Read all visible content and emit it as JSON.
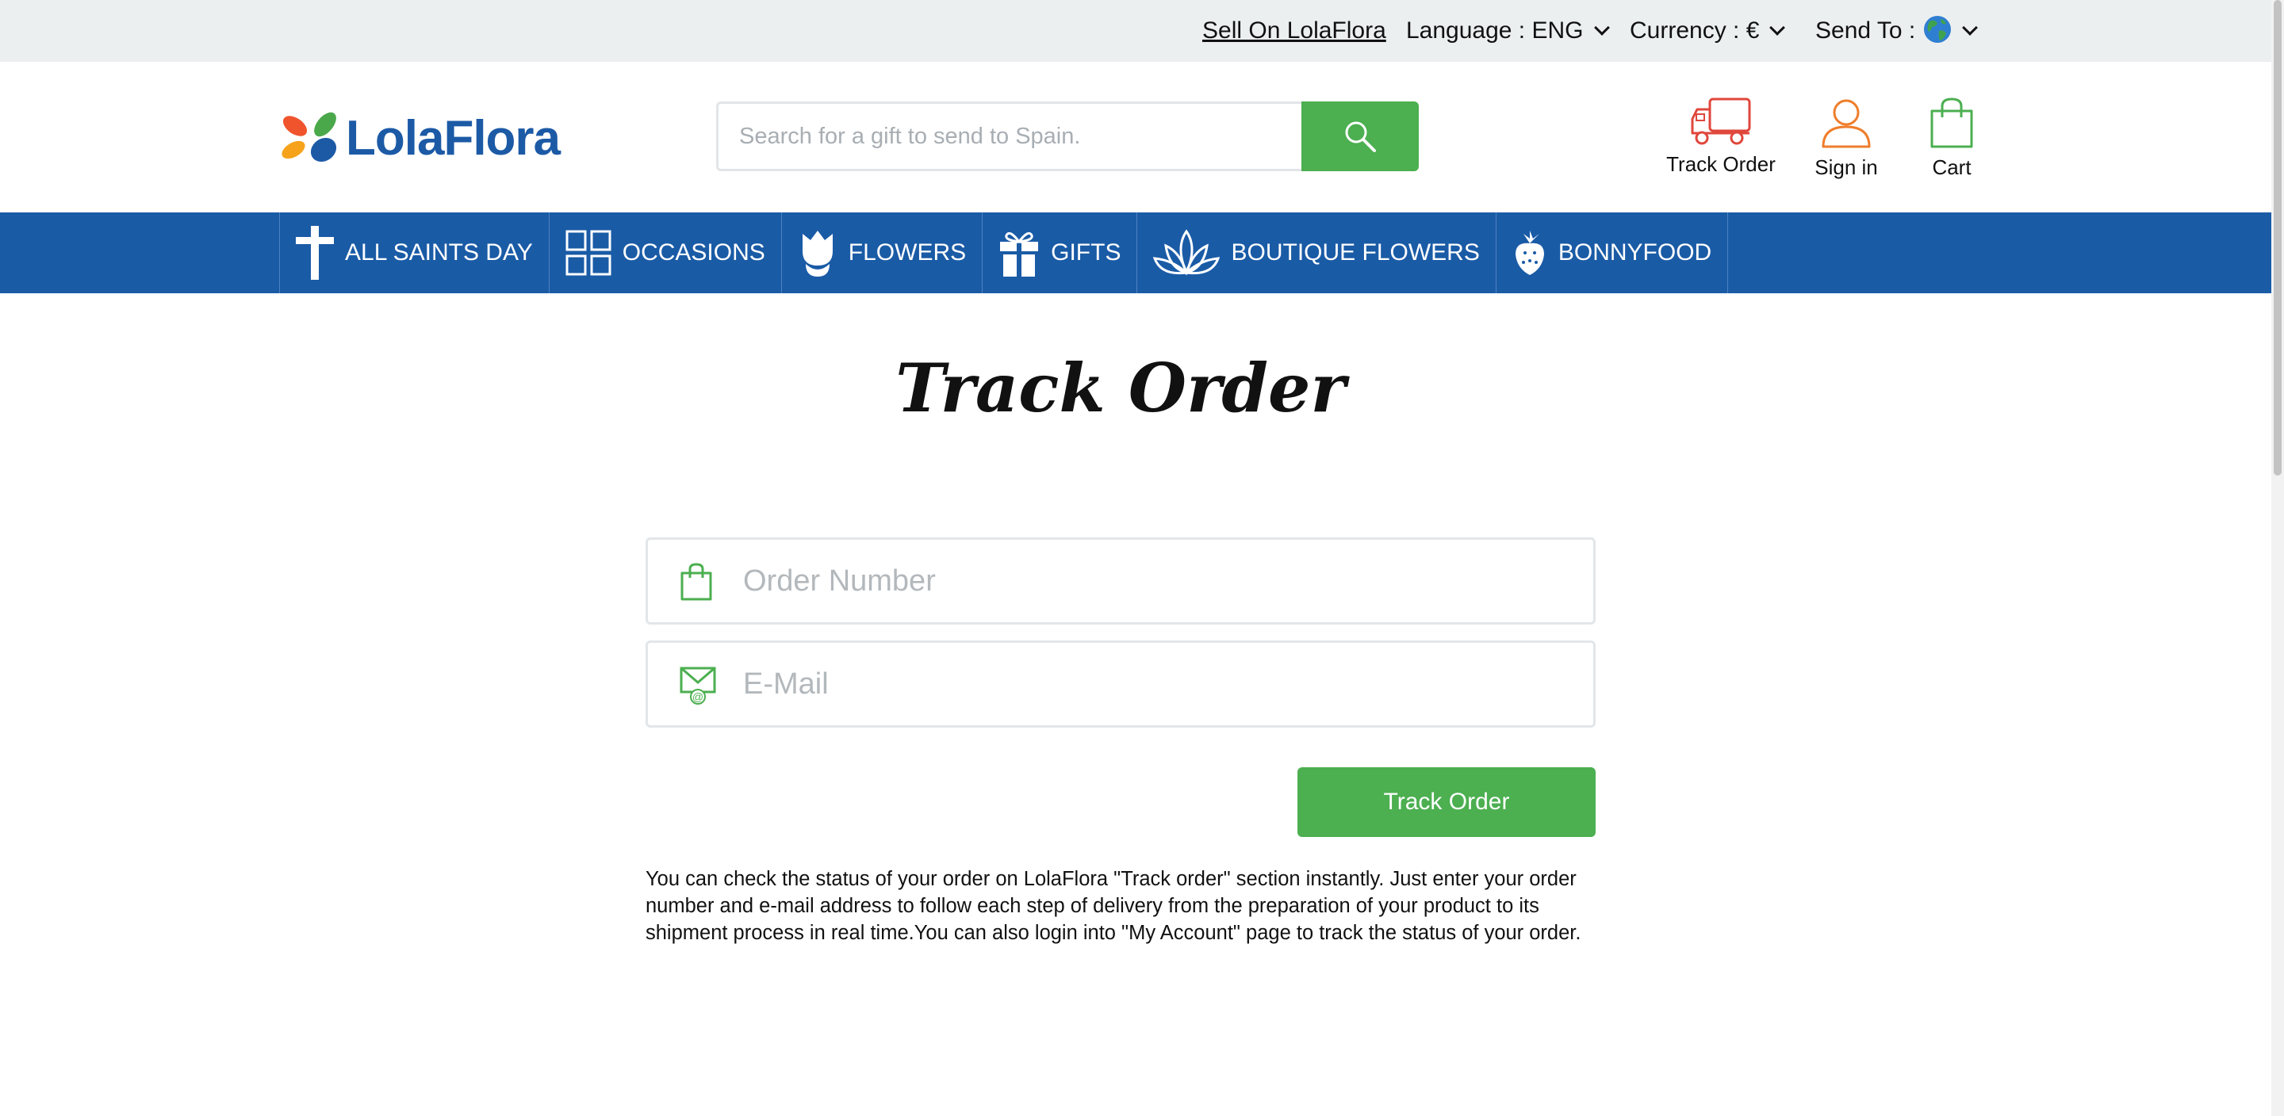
{
  "topbar": {
    "sell": "Sell On LolaFlora",
    "language": "Language : ENG",
    "currency": "Currency : €",
    "send_to": "Send To :"
  },
  "header": {
    "logo_text": "LolaFlora",
    "search_placeholder": "Search for a gift to send to Spain.",
    "track_order": "Track Order",
    "sign_in": "Sign in",
    "cart": "Cart"
  },
  "nav": {
    "items": [
      {
        "label": "ALL SAINTS DAY",
        "icon": "cross-icon"
      },
      {
        "label": "OCCASIONS",
        "icon": "grid-icon"
      },
      {
        "label": "FLOWERS",
        "icon": "tulip-icon"
      },
      {
        "label": "GIFTS",
        "icon": "gift-icon"
      },
      {
        "label": "BOUTIQUE FLOWERS",
        "icon": "lotus-icon"
      },
      {
        "label": "BONNYFOOD",
        "icon": "strawberry-icon"
      }
    ]
  },
  "main": {
    "title": "Track Order",
    "order_placeholder": "Order Number",
    "email_placeholder": "E-Mail",
    "submit_label": "Track Order",
    "description": "You can check the status of your order on LolaFlora \"Track order\" section instantly. Just enter your order number and e-mail address to follow each step of delivery from the preparation of your product to its shipment process in real time.You can also login into \"My Account\" page to track the status of your order."
  },
  "colors": {
    "nav_blue": "#1a5ba6",
    "accent_green": "#4caf50",
    "topbar_gray": "#eceff0",
    "truck_red": "#e0473c",
    "user_orange": "#ef7d2b"
  }
}
